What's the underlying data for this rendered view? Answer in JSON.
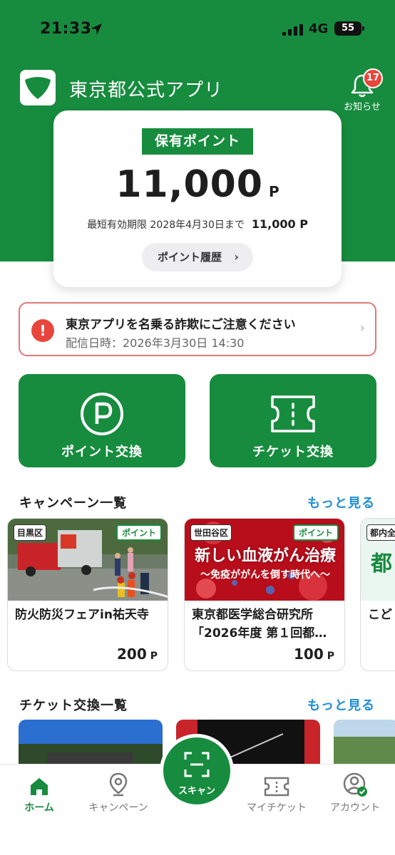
{
  "status_bar": {
    "time": "21:33",
    "network": "4G",
    "battery": "55"
  },
  "header": {
    "app_title": "東京都公式アプリ",
    "notice_label": "お知らせ",
    "notice_count": "17"
  },
  "points": {
    "tag": "保有ポイント",
    "value": "11,000",
    "unit": "P",
    "expiry_label": "最短有効期限 2028年4月30日まで",
    "expiry_value": "11,000 P",
    "history_button": "ポイント履歴"
  },
  "alert": {
    "title": "東京アプリを名乗る詐欺にご注意ください",
    "date": "配信日時：2026年3月30日 14:30"
  },
  "exchange": {
    "point_exchange": "ポイント交換",
    "ticket_exchange": "チケット交換"
  },
  "campaigns": {
    "title": "キャンペーン一覧",
    "more": "もっと見る",
    "items": [
      {
        "area": "目黒区",
        "tag": "ポイント",
        "title": "防火防災フェアin祐天寺",
        "price": "200",
        "unit": "P"
      },
      {
        "area": "世田谷区",
        "tag": "ポイント",
        "title": "東京都医学総合研究所「2026年度 第１回都…",
        "price": "100",
        "unit": "P",
        "banner_main": "新しい血液がん治療",
        "banner_sub": "〜免疫ががんを倒す時代へ〜"
      },
      {
        "area": "都内全",
        "title": "こど",
        "banner_main": "都"
      }
    ]
  },
  "tickets": {
    "title": "チケット交換一覧",
    "more": "もっと見る"
  },
  "nav": {
    "home": "ホーム",
    "campaign": "キャンペーン",
    "scan": "スキャン",
    "my_ticket": "マイチケット",
    "account": "アカウント"
  },
  "colors": {
    "brand_green": "#178c3e",
    "link_blue": "#1f8ed6",
    "alert_red": "#e8453c"
  }
}
